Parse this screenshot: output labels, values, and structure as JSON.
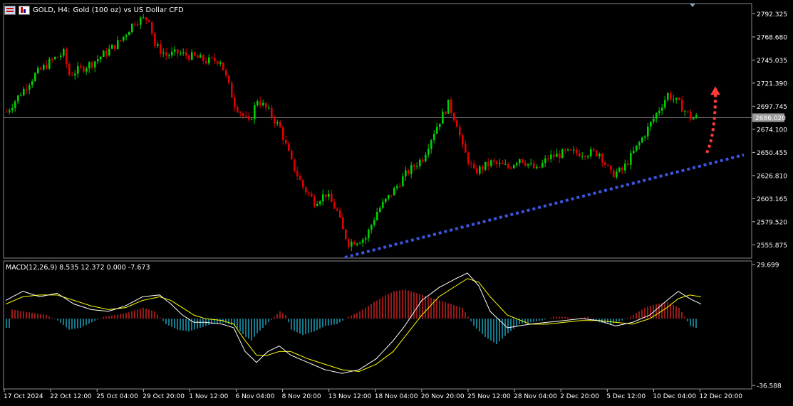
{
  "header": {
    "symbol": "GOLD, H4:",
    "description": "Gold (100 oz) vs US Dollar CFD"
  },
  "macd_label": "MACD(12,26,9) 8.535 12.372 0.000 -7.673",
  "colors": {
    "background": "#000000",
    "bull": "#00d000",
    "bear": "#e00000",
    "trendline": "#3a56e0",
    "arrow": "#ff3b3b",
    "macd_line": "#ffffff",
    "signal_line": "#ffff00",
    "hist_pos": "#ff2a2a",
    "hist_neg": "#22c8e8"
  },
  "chart_data": [
    {
      "type": "candlestick",
      "title": "",
      "y_ticks": [
        "2792.325",
        "2768.680",
        "2745.035",
        "2721.390",
        "2697.745",
        "2674.100",
        "2650.455",
        "2626.810",
        "2603.165",
        "2579.520",
        "2555.875"
      ],
      "ylim": [
        2543.0,
        2797.0
      ],
      "current_price": "2686.020",
      "x_ticks": [
        "17 Oct 2024",
        "22 Oct 12:00",
        "25 Oct 04:00",
        "29 Oct 20:00",
        "1 Nov 12:00",
        "6 Nov 04:00",
        "8 Nov 20:00",
        "13 Nov 12:00",
        "18 Nov 04:00",
        "20 Nov 20:00",
        "25 Nov 12:00",
        "28 Nov 04:00",
        "2 Dec 20:00",
        "5 Dec 12:00",
        "10 Dec 04:00",
        "12 Dec 20:00"
      ],
      "price_path": [
        [
          0,
          2692
        ],
        [
          6,
          2715
        ],
        [
          10,
          2730
        ],
        [
          16,
          2745
        ],
        [
          20,
          2752
        ],
        [
          22,
          2730
        ],
        [
          30,
          2742
        ],
        [
          36,
          2755
        ],
        [
          40,
          2765
        ],
        [
          45,
          2785
        ],
        [
          50,
          2788
        ],
        [
          52,
          2760
        ],
        [
          56,
          2750
        ],
        [
          60,
          2752
        ],
        [
          66,
          2748
        ],
        [
          70,
          2744
        ],
        [
          75,
          2745
        ],
        [
          80,
          2700
        ],
        [
          85,
          2680
        ],
        [
          88,
          2705
        ],
        [
          92,
          2692
        ],
        [
          96,
          2675
        ],
        [
          100,
          2640
        ],
        [
          104,
          2615
        ],
        [
          108,
          2600
        ],
        [
          112,
          2608
        ],
        [
          116,
          2590
        ],
        [
          118,
          2570
        ],
        [
          120,
          2558
        ],
        [
          126,
          2563
        ],
        [
          130,
          2590
        ],
        [
          136,
          2612
        ],
        [
          140,
          2628
        ],
        [
          146,
          2645
        ],
        [
          150,
          2672
        ],
        [
          155,
          2700
        ],
        [
          158,
          2680
        ],
        [
          160,
          2655
        ],
        [
          164,
          2630
        ],
        [
          170,
          2640
        ],
        [
          176,
          2635
        ],
        [
          180,
          2645
        ],
        [
          186,
          2632
        ],
        [
          190,
          2645
        ],
        [
          196,
          2650
        ],
        [
          202,
          2650
        ],
        [
          208,
          2650
        ],
        [
          212,
          2628
        ],
        [
          216,
          2632
        ],
        [
          222,
          2660
        ],
        [
          228,
          2690
        ],
        [
          232,
          2710
        ],
        [
          236,
          2700
        ],
        [
          240,
          2686
        ]
      ],
      "trendline": {
        "start": [
          119,
          2543
        ],
        "end": [
          259,
          2648
        ]
      },
      "arrow": {
        "from": [
          246,
          2650
        ],
        "to": [
          249,
          2718
        ]
      }
    },
    {
      "type": "macd",
      "title": "MACD(12,26,9)",
      "y_ticks": [
        "29.699",
        "-36.588"
      ],
      "ylim": [
        -36.588,
        29.699
      ],
      "values": {
        "macd": 8.535,
        "signal": 12.372,
        "histogram": 0.0,
        "extra": -7.673
      },
      "macd_path": [
        [
          0,
          10
        ],
        [
          6,
          15
        ],
        [
          12,
          12
        ],
        [
          18,
          14
        ],
        [
          24,
          8
        ],
        [
          30,
          5
        ],
        [
          36,
          4
        ],
        [
          42,
          7
        ],
        [
          48,
          12
        ],
        [
          54,
          13
        ],
        [
          58,
          8
        ],
        [
          62,
          2
        ],
        [
          66,
          -2
        ],
        [
          70,
          -2
        ],
        [
          76,
          -3
        ],
        [
          80,
          -5
        ],
        [
          84,
          -18
        ],
        [
          88,
          -24
        ],
        [
          92,
          -18
        ],
        [
          96,
          -15
        ],
        [
          100,
          -20
        ],
        [
          106,
          -24
        ],
        [
          112,
          -28
        ],
        [
          118,
          -30
        ],
        [
          124,
          -28
        ],
        [
          130,
          -22
        ],
        [
          136,
          -12
        ],
        [
          140,
          -4
        ],
        [
          146,
          10
        ],
        [
          152,
          17
        ],
        [
          158,
          22
        ],
        [
          162,
          25
        ],
        [
          166,
          18
        ],
        [
          170,
          4
        ],
        [
          176,
          -5
        ],
        [
          184,
          -3
        ],
        [
          190,
          -2
        ],
        [
          196,
          -1
        ],
        [
          202,
          0
        ],
        [
          208,
          -1
        ],
        [
          214,
          -4
        ],
        [
          220,
          -2
        ],
        [
          226,
          2
        ],
        [
          232,
          10
        ],
        [
          236,
          15
        ],
        [
          240,
          11
        ],
        [
          244,
          8
        ]
      ],
      "signal_path": [
        [
          0,
          8
        ],
        [
          6,
          12
        ],
        [
          12,
          13
        ],
        [
          18,
          13
        ],
        [
          24,
          10
        ],
        [
          30,
          7
        ],
        [
          36,
          5
        ],
        [
          42,
          6
        ],
        [
          48,
          10
        ],
        [
          54,
          12
        ],
        [
          58,
          10
        ],
        [
          62,
          6
        ],
        [
          66,
          2
        ],
        [
          70,
          0
        ],
        [
          76,
          -1
        ],
        [
          80,
          -3
        ],
        [
          84,
          -12
        ],
        [
          88,
          -20
        ],
        [
          92,
          -20
        ],
        [
          96,
          -18
        ],
        [
          100,
          -18
        ],
        [
          106,
          -22
        ],
        [
          112,
          -25
        ],
        [
          118,
          -28
        ],
        [
          124,
          -29
        ],
        [
          130,
          -25
        ],
        [
          136,
          -18
        ],
        [
          140,
          -10
        ],
        [
          146,
          2
        ],
        [
          152,
          12
        ],
        [
          158,
          18
        ],
        [
          162,
          22
        ],
        [
          166,
          20
        ],
        [
          170,
          12
        ],
        [
          176,
          2
        ],
        [
          184,
          -3
        ],
        [
          190,
          -3
        ],
        [
          196,
          -2
        ],
        [
          202,
          -1
        ],
        [
          208,
          -1
        ],
        [
          214,
          -2
        ],
        [
          220,
          -3
        ],
        [
          226,
          0
        ],
        [
          232,
          6
        ],
        [
          236,
          11
        ],
        [
          240,
          13
        ],
        [
          244,
          12
        ]
      ],
      "histogram": [
        [
          2,
          5
        ],
        [
          6,
          4
        ],
        [
          10,
          3
        ],
        [
          14,
          2
        ],
        [
          18,
          -1
        ],
        [
          22,
          -6
        ],
        [
          26,
          -5
        ],
        [
          30,
          -2
        ],
        [
          34,
          1
        ],
        [
          38,
          2
        ],
        [
          42,
          3
        ],
        [
          48,
          6
        ],
        [
          52,
          4
        ],
        [
          56,
          -3
        ],
        [
          60,
          -6
        ],
        [
          64,
          -7
        ],
        [
          68,
          -5
        ],
        [
          72,
          -3
        ],
        [
          76,
          -2
        ],
        [
          80,
          -4
        ],
        [
          84,
          -10
        ],
        [
          86,
          -12
        ],
        [
          88,
          -8
        ],
        [
          92,
          -2
        ],
        [
          96,
          4
        ],
        [
          98,
          2
        ],
        [
          100,
          -6
        ],
        [
          104,
          -9
        ],
        [
          108,
          -7
        ],
        [
          112,
          -4
        ],
        [
          116,
          -3
        ],
        [
          118,
          -1
        ],
        [
          120,
          1
        ],
        [
          124,
          4
        ],
        [
          128,
          8
        ],
        [
          132,
          12
        ],
        [
          136,
          15
        ],
        [
          140,
          16
        ],
        [
          144,
          14
        ],
        [
          148,
          12
        ],
        [
          152,
          10
        ],
        [
          156,
          8
        ],
        [
          160,
          6
        ],
        [
          164,
          -4
        ],
        [
          168,
          -10
        ],
        [
          172,
          -14
        ],
        [
          176,
          -8
        ],
        [
          180,
          -3
        ],
        [
          184,
          -2
        ],
        [
          188,
          -1
        ],
        [
          192,
          1
        ],
        [
          196,
          1
        ],
        [
          200,
          0
        ],
        [
          204,
          1
        ],
        [
          208,
          -2
        ],
        [
          212,
          -3
        ],
        [
          216,
          -1
        ],
        [
          220,
          2
        ],
        [
          224,
          6
        ],
        [
          228,
          8
        ],
        [
          232,
          9
        ],
        [
          236,
          6
        ],
        [
          240,
          -4
        ],
        [
          242,
          -5
        ]
      ]
    }
  ]
}
